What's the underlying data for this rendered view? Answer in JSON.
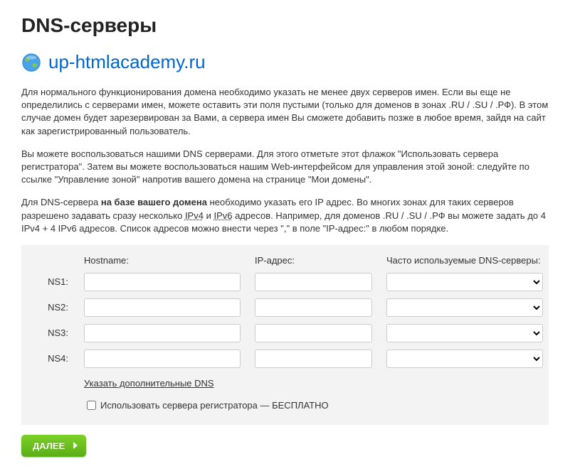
{
  "title": "DNS-серверы",
  "domain": "up-htmlacademy.ru",
  "intro": {
    "p1": "Для нормального функционирования домена необходимо указать не менее двух серверов имен. Если вы еще не определились с серверами имен, можете оставить эти поля пустыми (только для доменов в зонах .RU / .SU / .РФ). В этом случае домен будет зарезервирован за Вами, а сервера имен Вы сможете добавить позже в любое время, зайдя на сайт как зарегистрированный пользователь.",
    "p2": "Вы можете воспользоваться нашими DNS серверами. Для этого отметьте этот флажок \"Использовать сервера регистратора\". Затем вы можете воспользоваться нашим Web-интерфейсом для управления этой зоной: следуйте по ссылке \"Управление зоной\" напротив вашего домена на странице \"Мои домены\".",
    "p3_pre": "Для DNS-сервера ",
    "p3_bold": "на базе вашего домена",
    "p3_mid": " необходимо указать его IP адрес. Во многих зонах для таких серверов разрешено задавать сразу несколько ",
    "p3_link_ipv4": "IPv4",
    "p3_and": " и ",
    "p3_link_ipv6": "IPv6",
    "p3_post": " адресов. Например, для доменов .RU / .SU / .РФ вы можете задать до 4 IPv4 + 4 IPv6 адресов. Список адресов можно внести через \",\" в поле \"IP-адрес:\" в любом порядке."
  },
  "form": {
    "headers": {
      "hostname": "Hostname:",
      "ip": "IP-адрес:",
      "freq": "Часто используемые DNS-серверы:"
    },
    "rows": [
      {
        "label": "NS1:"
      },
      {
        "label": "NS2:"
      },
      {
        "label": "NS3:"
      },
      {
        "label": "NS4:"
      }
    ],
    "more_link": "Указать дополнительные DNS ",
    "checkbox_label": "Использовать сервера регистратора — БЕСПЛАТНО"
  },
  "submit_label": "ДАЛЕЕ"
}
